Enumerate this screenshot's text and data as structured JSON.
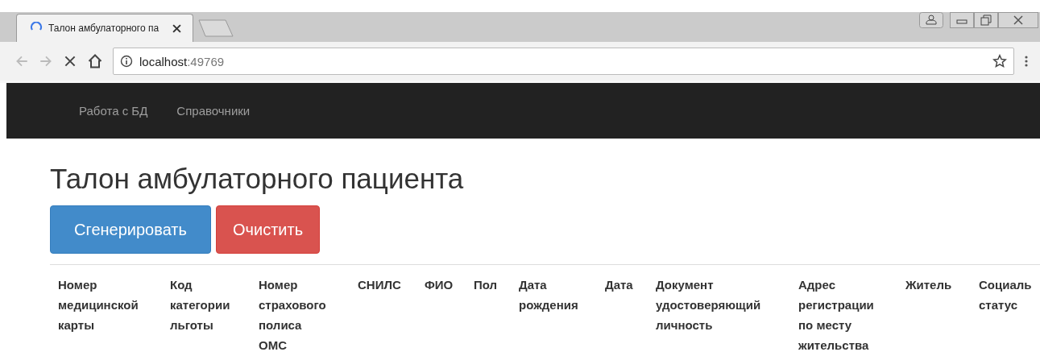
{
  "browser": {
    "tab_title": "Талон амбулаторного па",
    "address": {
      "host": "localhost",
      "port": ":49769"
    }
  },
  "navbar": {
    "items": [
      "Работа с БД",
      "Справочники"
    ]
  },
  "page": {
    "title": "Талон амбулаторного пациента",
    "buttons": [
      {
        "label": "Сгенерировать",
        "kind": "primary"
      },
      {
        "label": "Очистить",
        "kind": "danger"
      }
    ],
    "table": {
      "columns": [
        "Номер\nмедицинской\nкарты",
        "Код\nкатегории\nльготы",
        "Номер\nстрахового\nполиса\nОМС",
        "СНИЛС",
        "ФИО",
        "Пол",
        "Дата\nрождения",
        "Дата",
        "Документ\nудостоверяющий\nличность",
        "Адрес\nрегистрации\nпо месту\nжительства",
        "Житель",
        "Социаль\nстатус"
      ]
    }
  }
}
